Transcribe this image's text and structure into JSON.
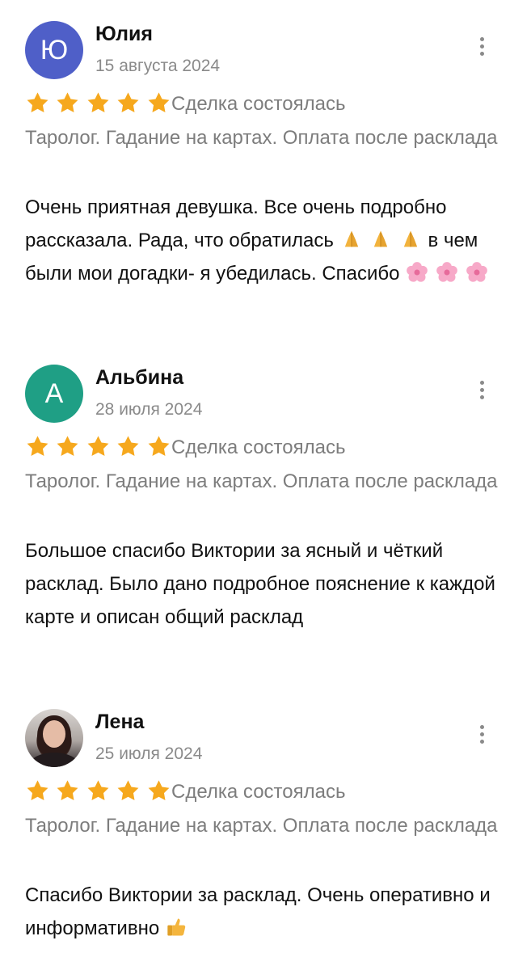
{
  "colors": {
    "star": "#f6a81d",
    "avatar_yulia": "#4f5fc8",
    "avatar_albina": "#1f9f85",
    "muted_text": "#7d7d7d",
    "date_text": "#8a8a8a"
  },
  "reviews": [
    {
      "avatar_letter": "Ю",
      "name": "Юлия",
      "date": "15 августа 2024",
      "rating": 5,
      "status": "Сделка состоялась",
      "service": "Таролог. Гадание на картах. Оплата после расклада",
      "text_parts": [
        "Очень приятная девушка. Все очень подробно рассказала. Рада, что обратилась ",
        " в чем были мои догадки- я убедилась. Спасибо"
      ],
      "emoji_names": [
        "folded-hands-icon",
        "cherry-blossom-icon"
      ]
    },
    {
      "avatar_letter": "А",
      "name": "Альбина",
      "date": "28 июля 2024",
      "rating": 5,
      "status": "Сделка состоялась",
      "service": "Таролог. Гадание на картах. Оплата после расклада",
      "text": "Большое спасибо Виктории за ясный и чёткий расклад. Было дано подробное пояснение к каждой карте и описан общий расклад"
    },
    {
      "name": "Лена",
      "date": "25 июля 2024",
      "rating": 5,
      "status": "Сделка состоялась",
      "service": "Таролог. Гадание на картах. Оплата после расклада",
      "text": "Спасибо Виктории за расклад. Очень оперативно и информативно ",
      "emoji_names": [
        "thumbs-up-icon"
      ]
    }
  ]
}
